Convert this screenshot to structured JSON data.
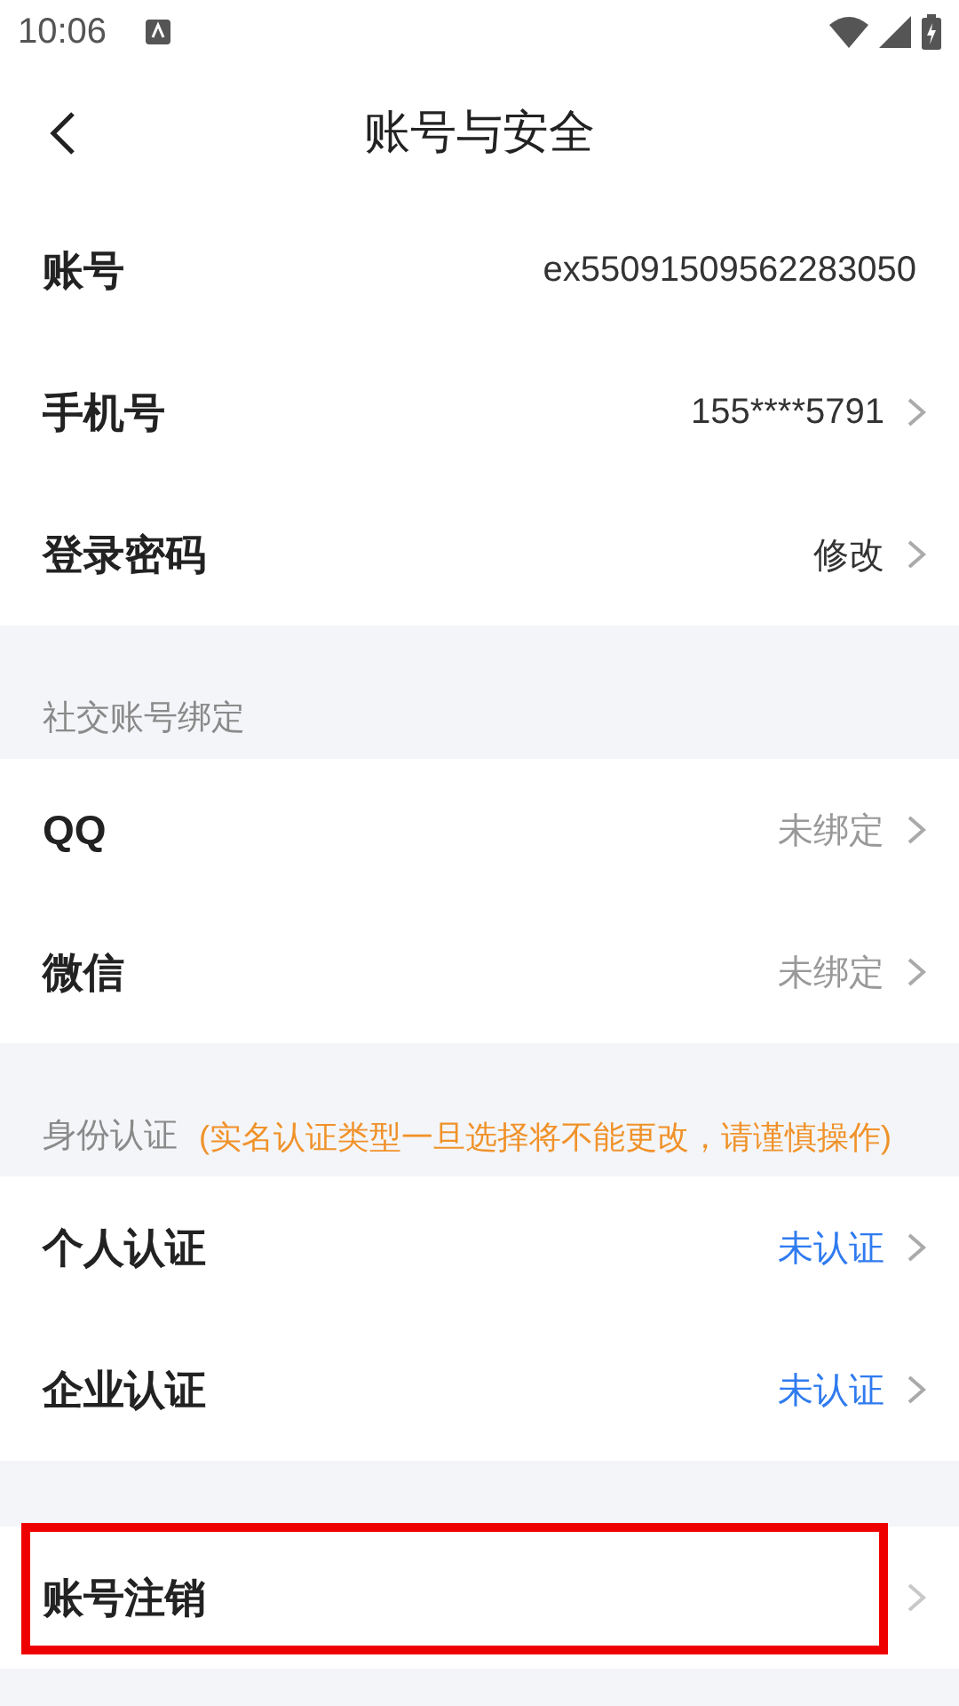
{
  "status_bar": {
    "time": "10:06"
  },
  "header": {
    "title": "账号与安全"
  },
  "groups": [
    {
      "rows": [
        {
          "label": "账号",
          "value": "ex55091509562283050",
          "kind": "plain",
          "chevron": false,
          "highlighted": false
        },
        {
          "label": "手机号",
          "value": "155****5791",
          "kind": "plain",
          "chevron": true,
          "highlighted": false
        },
        {
          "label": "登录密码",
          "value": "修改",
          "kind": "plain",
          "chevron": true,
          "highlighted": false
        }
      ]
    },
    {
      "section": {
        "title": "社交账号绑定"
      },
      "rows": [
        {
          "label": "QQ",
          "value": "未绑定",
          "kind": "muted",
          "chevron": true,
          "highlighted": false
        },
        {
          "label": "微信",
          "value": "未绑定",
          "kind": "muted",
          "chevron": true,
          "highlighted": false
        }
      ]
    },
    {
      "section": {
        "title": "身份认证",
        "note": "(实名认证类型一旦选择将不能更改，请谨慎操作)"
      },
      "rows": [
        {
          "label": "个人认证",
          "value": "未认证",
          "kind": "link",
          "chevron": true,
          "highlighted": false
        },
        {
          "label": "企业认证",
          "value": "未认证",
          "kind": "link",
          "chevron": true,
          "highlighted": false
        }
      ]
    },
    {
      "rows": [
        {
          "label": "账号注销",
          "chevron": true,
          "highlighted": true
        }
      ]
    }
  ]
}
